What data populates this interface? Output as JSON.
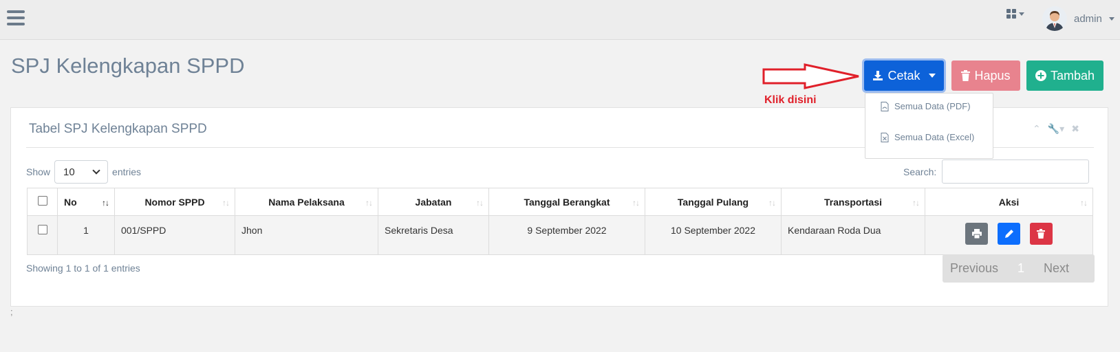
{
  "navbar": {
    "menu_icon": "hamburger-icon",
    "apps_icon": "grid-icon",
    "user_name": "admin"
  },
  "page": {
    "title": "SPJ Kelengkapan SPPD"
  },
  "actions": {
    "cetak_label": "Cetak",
    "hapus_label": "Hapus",
    "tambah_label": "Tambah",
    "colors": {
      "cetak": "#0d62d9",
      "hapus": "#e8838e",
      "tambah": "#20b08e"
    }
  },
  "annotation": {
    "text": "Klik disini",
    "color": "#e0202a"
  },
  "dropdown": {
    "items": [
      {
        "label": "Semua Data (PDF)",
        "icon": "pdf-file-icon"
      },
      {
        "label": "Semua Data (Excel)",
        "icon": "excel-file-icon"
      }
    ]
  },
  "panel": {
    "title": "Tabel SPJ Kelengkapan SPPD",
    "show_label": "Show",
    "entries_label": "entries",
    "page_length": "10",
    "search_label": "Search:",
    "search_value": ""
  },
  "table": {
    "headers": [
      "No",
      "Nomor SPPD",
      "Nama Pelaksana",
      "Jabatan",
      "Tanggal Berangkat",
      "Tanggal Pulang",
      "Transportasi",
      "Aksi"
    ],
    "rows": [
      {
        "no": "1",
        "nomor_sppd": "001/SPPD",
        "nama_pelaksana": "Jhon",
        "jabatan": "Sekretaris Desa",
        "tanggal_berangkat": "9 September 2022",
        "tanggal_pulang": "10 September 2022",
        "transportasi": "Kendaraan Roda Dua"
      }
    ],
    "row_actions": [
      {
        "icon": "print-icon",
        "color": "#6c757d"
      },
      {
        "icon": "edit-icon",
        "color": "#0d6efd"
      },
      {
        "icon": "trash-icon",
        "color": "#dc3545"
      }
    ]
  },
  "footer": {
    "info": "Showing 1 to 1 of 1 entries",
    "prev_label": "Previous",
    "current_page": "1",
    "next_label": "Next",
    "note": ";"
  }
}
